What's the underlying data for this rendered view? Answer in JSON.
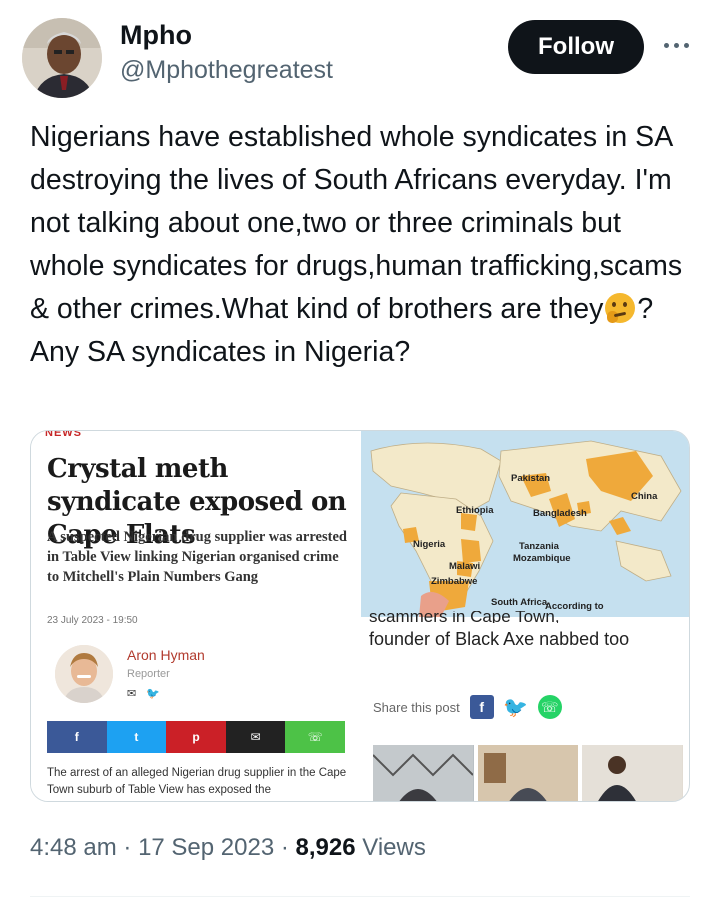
{
  "author": {
    "name": "Mpho",
    "handle": "@Mphothegreatest",
    "avatar_icon": "profile-photo"
  },
  "actions": {
    "follow_label": "Follow",
    "more_icon": "ellipsis-icon"
  },
  "tweet": {
    "text_before_emoji": "Nigerians have established whole syndicates in SA destroying the lives of South Africans everyday. I'm not talking about one,two or three criminals but whole syndicates for drugs,human trafficking,scams & other crimes.What kind of brothers are they",
    "emoji": "thinking-face",
    "text_after_emoji": "?Any SA syndicates in Nigeria?"
  },
  "media": {
    "left": {
      "section_label": "NEWS",
      "headline": "Crystal meth syndicate exposed on Cape Flats",
      "subheadline": "A suspected Nigerian drug supplier was arrested in Table View linking Nigerian organised crime to Mitchell's Plain Numbers Gang",
      "date": "23 July 2023 - 19:50",
      "author_name": "Aron Hyman",
      "author_role": "Reporter",
      "share_buttons": [
        {
          "icon": "f",
          "color": "#3b5998"
        },
        {
          "icon": "t",
          "color": "#1da1f2"
        },
        {
          "icon": "p",
          "color": "#cb2027"
        },
        {
          "icon": "e",
          "color": "#222222"
        },
        {
          "icon": "w",
          "color": "#4dc247"
        }
      ],
      "caption": "The arrest of an alleged Nigerian drug supplier in the Cape Town suburb of Table View has exposed the"
    },
    "right": {
      "map_labels": [
        "Pakistan",
        "China",
        "Ethiopia",
        "Bangladesh",
        "Nigeria",
        "Tanzania",
        "Mozambique",
        "Malawi",
        "Zimbabwe",
        "South Africa",
        "According to"
      ],
      "cut_line": "scammers in Cape Town,",
      "headline": "founder of Black Axe nabbed too",
      "share_label": "Share this post"
    }
  },
  "footer": {
    "time": "4:48 am",
    "date": "17 Sep 2023",
    "views_count": "8,926",
    "views_label": "Views"
  }
}
